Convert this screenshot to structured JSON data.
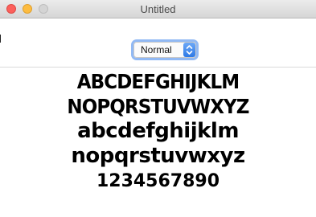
{
  "window": {
    "title": "Untitled"
  },
  "toolbar": {
    "style_popup": {
      "selected": "Normal"
    }
  },
  "sample": {
    "lines": [
      "ABCDEFGHIJKLM",
      "NOPQRSTUVWXYZ",
      "abcdefghijklm",
      "nopqrstuvwxyz",
      "1234567890"
    ]
  },
  "colors": {
    "close": "#fc605c",
    "minimize": "#fdbc40",
    "zoom": "#d4d4d4",
    "accent": "#2d79e6"
  }
}
